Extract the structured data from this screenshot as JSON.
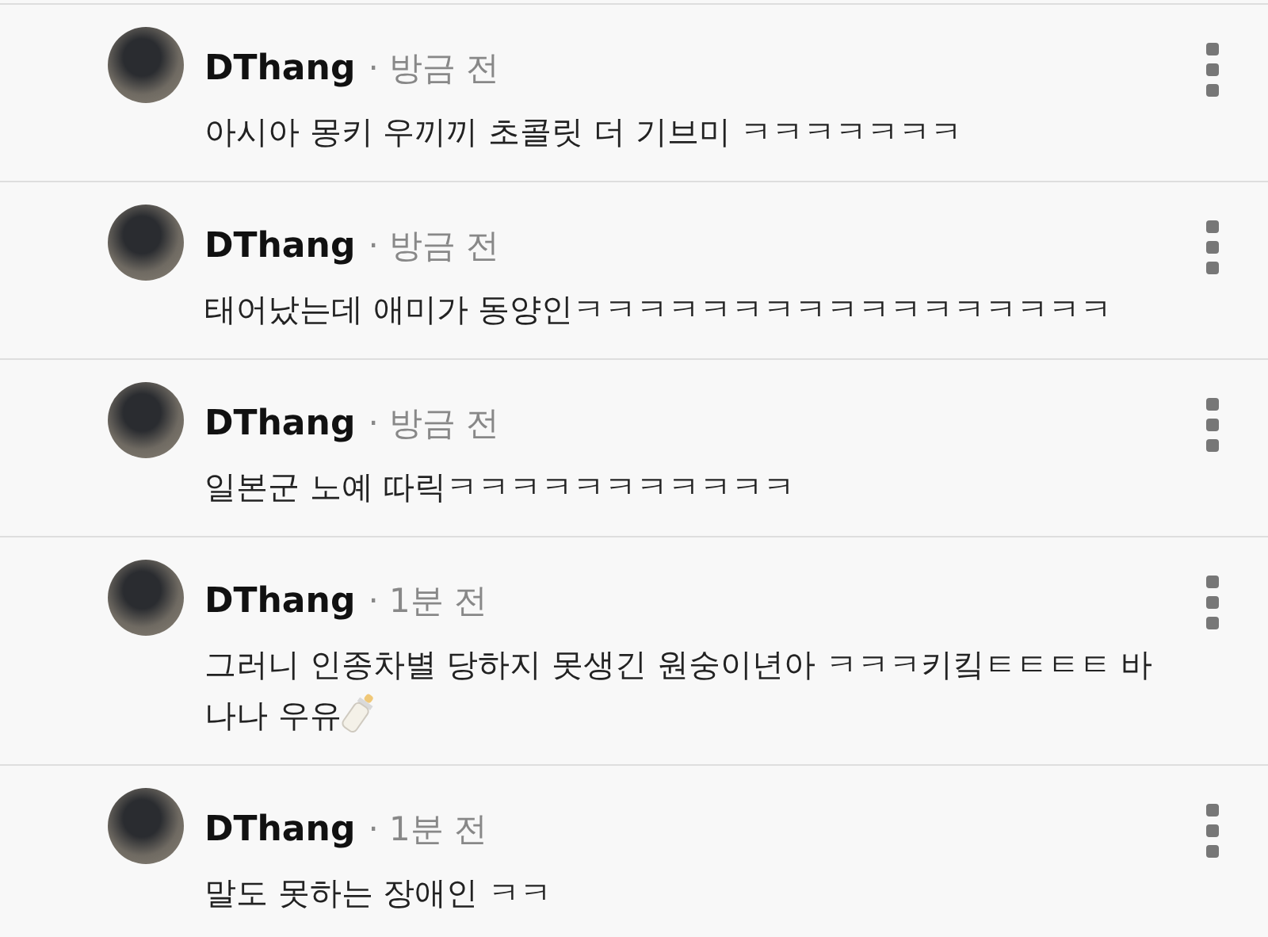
{
  "comments": [
    {
      "author": "DThang",
      "time": "· 방금 전",
      "text": "아시아 몽키 우끼끼 초콜릿 더 기브미 ㅋㅋㅋㅋㅋㅋㅋ",
      "emoji": false
    },
    {
      "author": "DThang",
      "time": "· 방금 전",
      "text": "태어났는데 애미가 동양인ㅋㅋㅋㅋㅋㅋㅋㅋㅋㅋㅋㅋㅋㅋㅋㅋㅋ",
      "emoji": false
    },
    {
      "author": "DThang",
      "time": "· 방금 전",
      "text": "일본군 노예 따릭ㅋㅋㅋㅋㅋㅋㅋㅋㅋㅋㅋ",
      "emoji": false
    },
    {
      "author": "DThang",
      "time": "· 1분 전",
      "text": "그러니 인종차별 당하지 못생긴 원숭이년아 ㅋㅋㅋ키킼ㅌㅌㅌㅌ 바나나 우유",
      "emoji": true
    },
    {
      "author": "DThang",
      "time": "· 1분 전",
      "text": "말도 못하는 장애인 ㅋㅋ",
      "emoji": false
    }
  ]
}
